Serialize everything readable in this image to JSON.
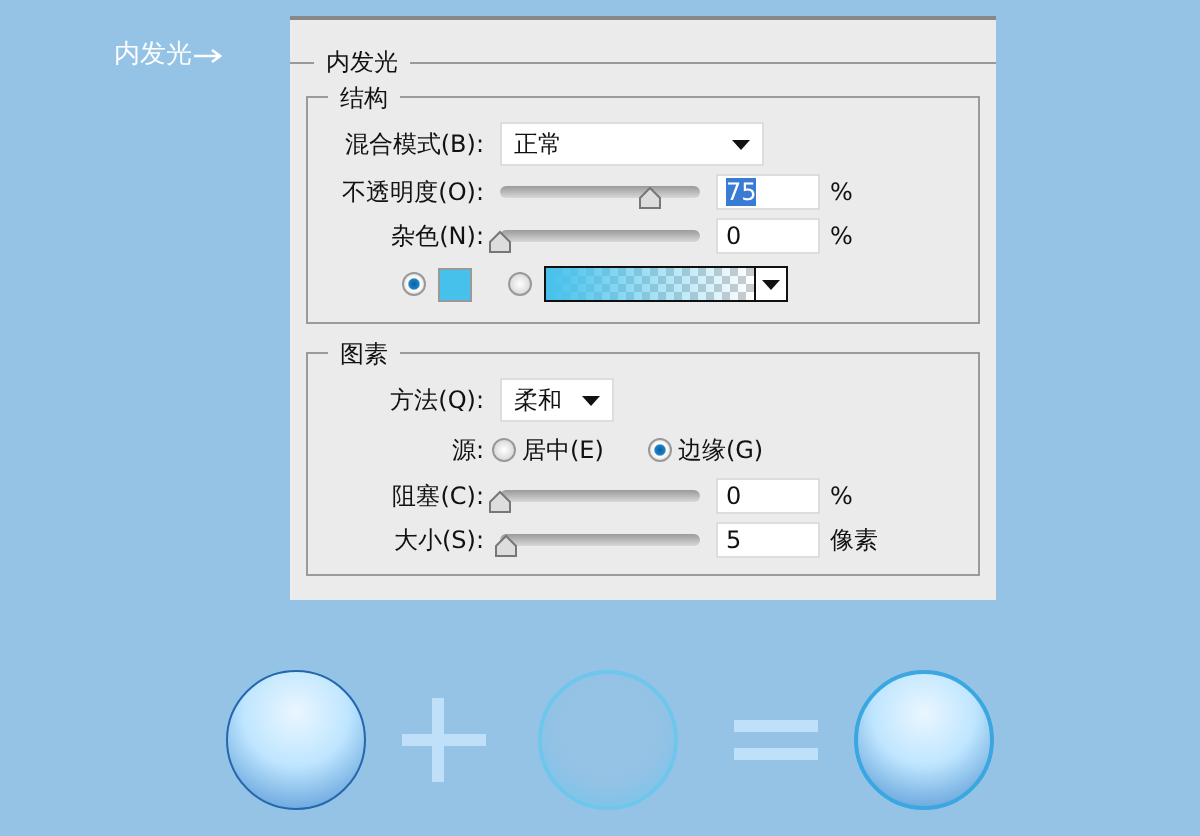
{
  "callout": {
    "label": "内发光"
  },
  "dialog": {
    "title": "内发光",
    "structure": {
      "title": "结构",
      "blend_mode": {
        "label": "混合模式(B):",
        "value": "正常"
      },
      "opacity": {
        "label": "不透明度(O):",
        "level": 0.75,
        "value": "75",
        "unit": "%",
        "highlighted": true
      },
      "noise": {
        "label": "杂色(N):",
        "level": 0,
        "value": "0",
        "unit": "%",
        "highlighted": false
      },
      "fill_options": [
        {
          "kind": "color",
          "selected": true,
          "color": "#45c1ec"
        },
        {
          "kind": "gradient",
          "selected": false,
          "color": "#45c1ec"
        }
      ]
    },
    "elements": {
      "title": "图素",
      "technique": {
        "label": "方法(Q):",
        "value": "柔和"
      },
      "source": {
        "label": "源:",
        "options": [
          {
            "label": "居中(E)",
            "selected": false
          },
          {
            "label": "边缘(G)",
            "selected": true
          }
        ]
      },
      "choke": {
        "label": "阻塞(C):",
        "level": 0,
        "value": "0",
        "unit": "%",
        "highlighted": false
      },
      "size": {
        "label": "大小(S):",
        "level": 0.03,
        "value": "5",
        "unit": "像素",
        "highlighted": false
      }
    }
  }
}
